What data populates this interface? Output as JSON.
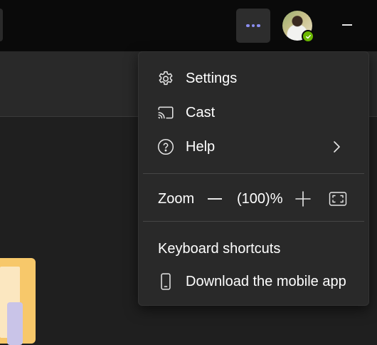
{
  "titlebar": {
    "more_icon": "more-horizontal-icon",
    "avatar_status": "available",
    "minimize_icon": "minimize-icon"
  },
  "colors": {
    "accent": "#8b8ef0",
    "presence_available": "#6bb700",
    "menu_bg": "#292929",
    "titlebar_bg": "#0a0a0a"
  },
  "menu": {
    "settings": {
      "label": "Settings",
      "icon": "gear-icon"
    },
    "cast": {
      "label": "Cast",
      "icon": "cast-icon"
    },
    "help": {
      "label": "Help",
      "icon": "help-circle-icon",
      "submenu_icon": "chevron-right-icon"
    },
    "zoom": {
      "label": "Zoom",
      "value": "(100)%",
      "decrease_icon": "minus-icon",
      "increase_icon": "plus-icon",
      "fullscreen_icon": "fullscreen-icon"
    },
    "keyboard_shortcuts": {
      "label": "Keyboard shortcuts"
    },
    "download_mobile": {
      "label": "Download the mobile app",
      "icon": "phone-icon"
    }
  }
}
